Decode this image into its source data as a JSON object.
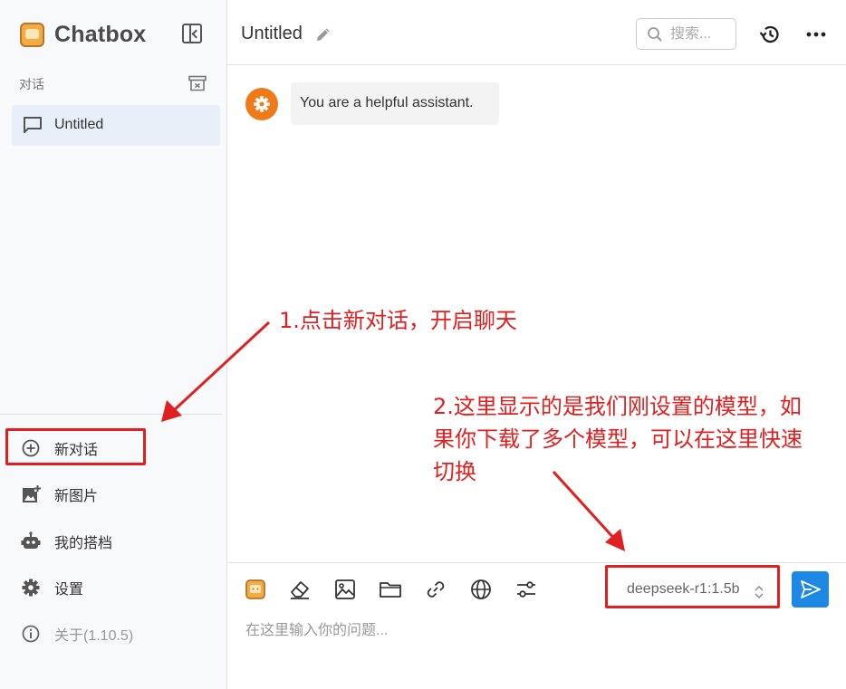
{
  "app": {
    "name": "Chatbox"
  },
  "sidebar": {
    "section_label": "对话",
    "sessions": [
      {
        "label": "Untitled"
      }
    ],
    "menu": {
      "new_chat": "新对话",
      "new_image": "新图片",
      "my_copilots": "我的搭档",
      "settings": "设置",
      "about": "关于(1.10.5)"
    }
  },
  "header": {
    "title": "Untitled",
    "search_placeholder": "搜索..."
  },
  "messages": [
    {
      "role": "system",
      "text": "You are a helpful assistant."
    }
  ],
  "input": {
    "placeholder": "在这里输入你的问题...",
    "model": "deepseek-r1:1.5b"
  },
  "annotations": {
    "note1": "1.点击新对话，开启聊天",
    "note2_line1": "2.这里显示的是我们刚设置的模型，如",
    "note2_line2": "果你下载了多个模型，可以在这里快速",
    "note2_line3": "切换"
  },
  "colors": {
    "accent": "#1e88e5",
    "annotation": "#e02020",
    "system_avatar": "#ee7a1a",
    "active_session": "#e8eff8"
  }
}
